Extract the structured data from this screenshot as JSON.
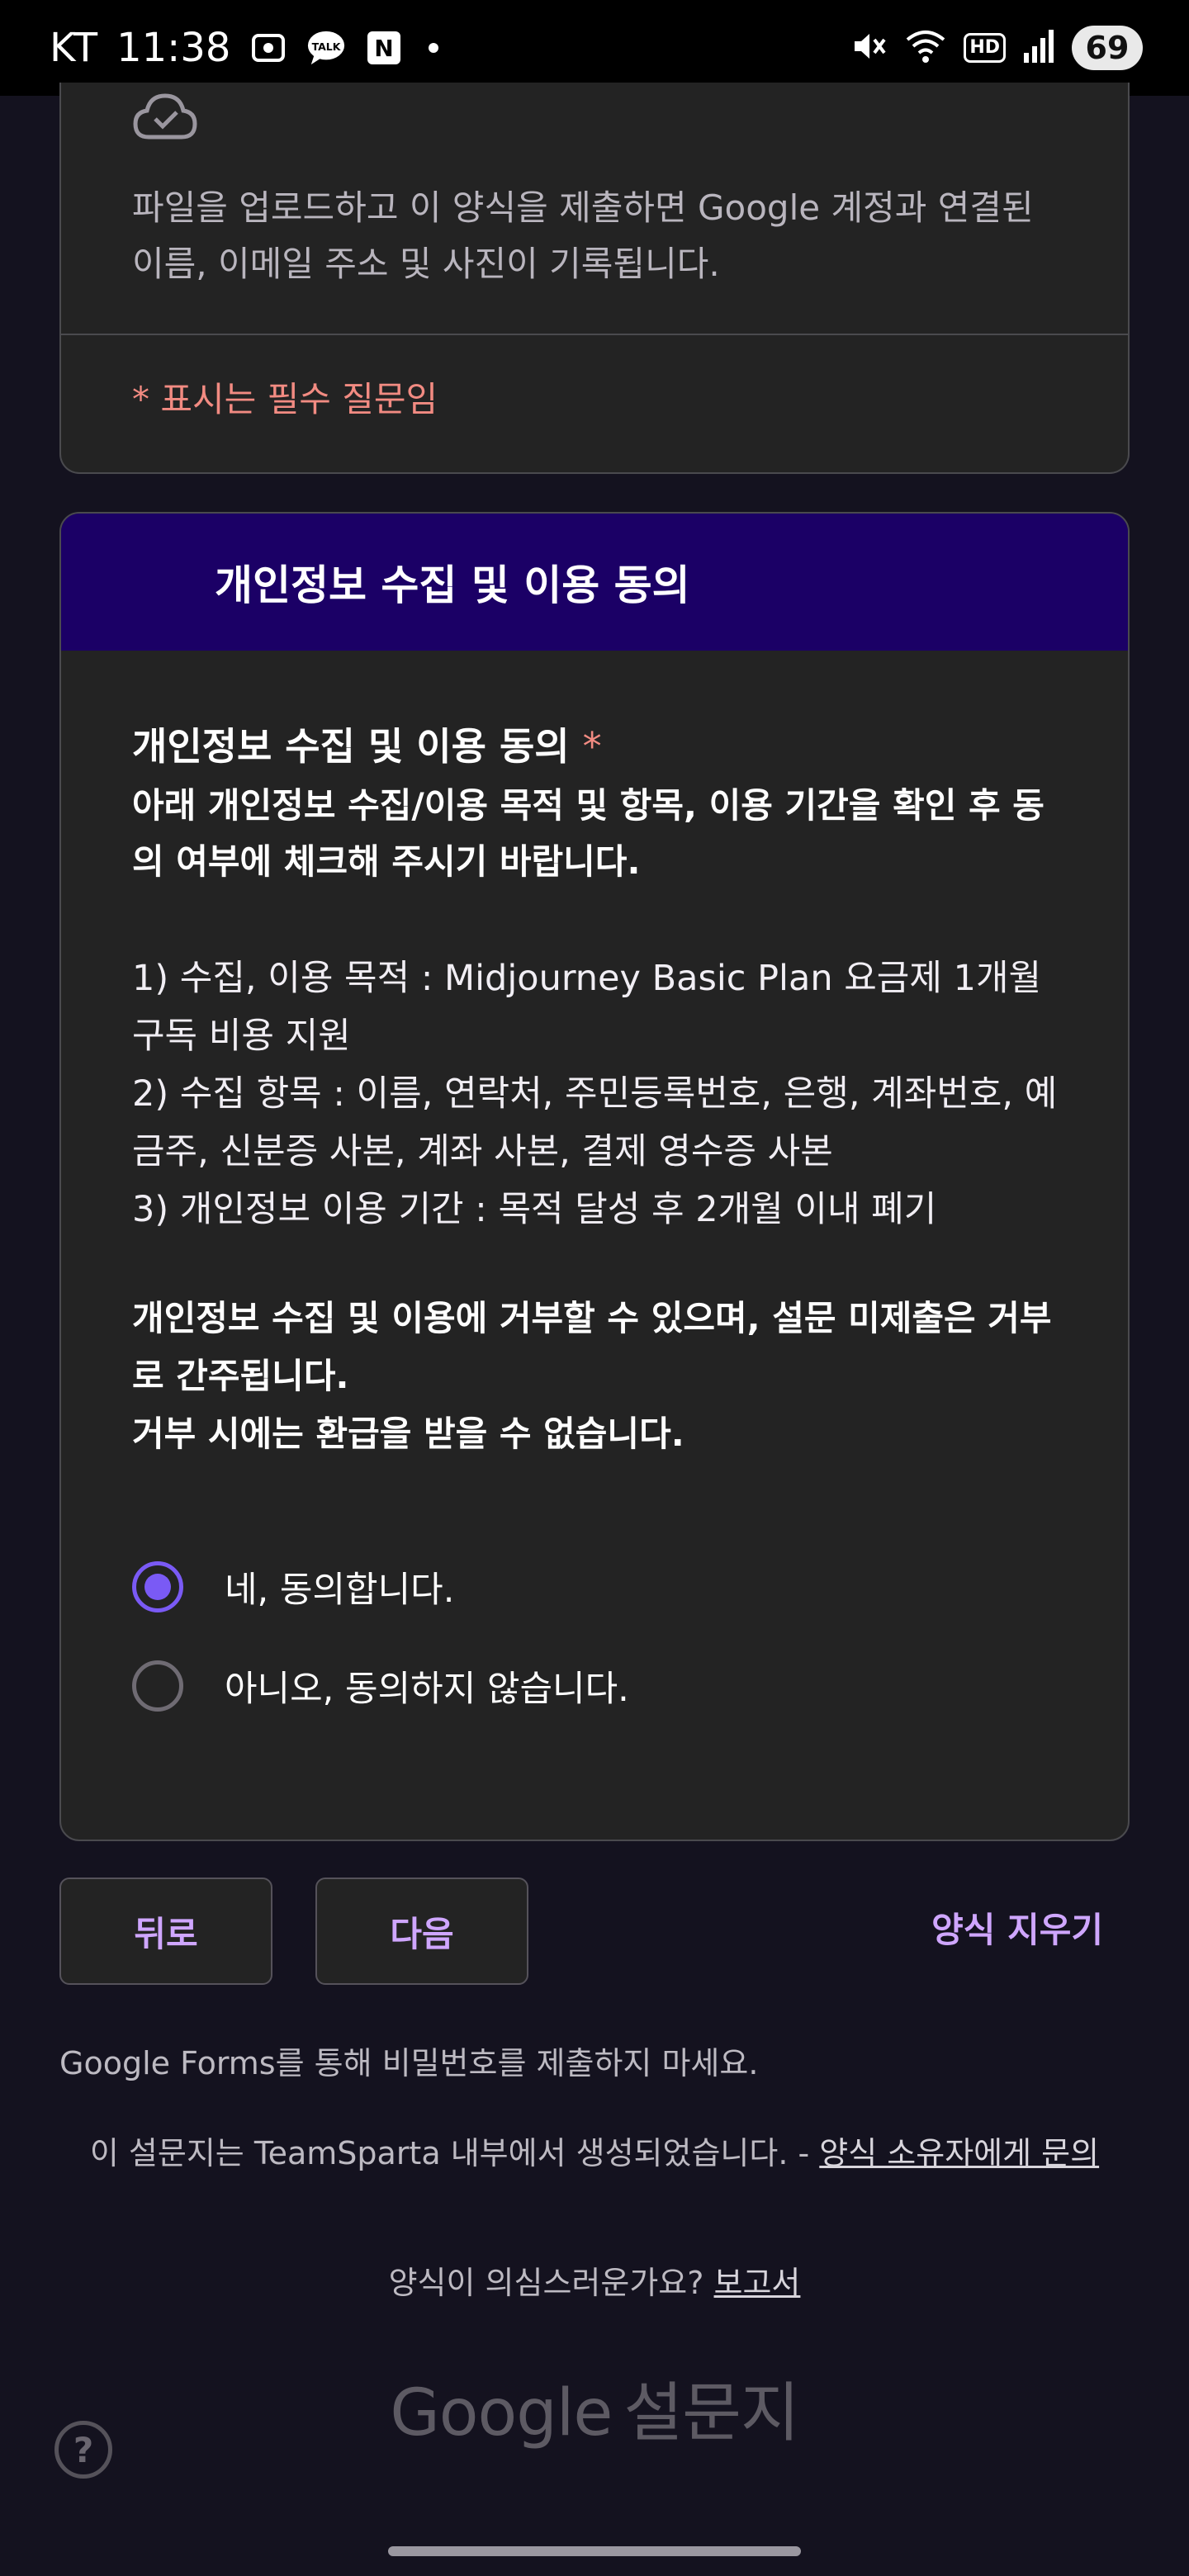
{
  "status_bar": {
    "carrier": "KT",
    "time": "11:38",
    "talk_label": "TALK",
    "n_label": "N",
    "hd_label": "HD",
    "battery": "69"
  },
  "upload_card": {
    "notice": "파일을 업로드하고 이 양식을 제출하면 Google 계정과 연결된 이름, 이메일 주소 및 사진이 기록됩니다.",
    "required_notice": "* 표시는 필수 질문임"
  },
  "section": {
    "title": "개인정보 수집 및 이용 동의",
    "question": {
      "title": "개인정보 수집 및 이용 동의",
      "required_mark": "*",
      "instruction": "아래 개인정보 수집/이용 목적 및 항목, 이용 기간을 확인 후 동의 여부에 체크해 주시기 바랍니다.",
      "item1": "1) 수집, 이용 목적 : Midjourney Basic Plan 요금제 1개월 구독 비용 지원",
      "item2": "2) 수집 항목 : 이름, 연락처, 주민등록번호, 은행, 계좌번호, 예금주, 신분증 사본, 계좌 사본, 결제 영수증 사본",
      "item3": "3) 개인정보 이용 기간 : 목적 달성 후 2개월 이내 폐기",
      "notice_line1": "개인정보 수집 및 이용에 거부할 수 있으며, 설문 미제출은 거부로 간주됩니다.",
      "notice_line2": "거부 시에는 환급을 받을 수 없습니다.",
      "options": [
        {
          "label": "네, 동의합니다.",
          "selected": true
        },
        {
          "label": "아니오, 동의하지 않습니다.",
          "selected": false
        }
      ]
    }
  },
  "navigation": {
    "back_label": "뒤로",
    "next_label": "다음",
    "clear_label": "양식 지우기"
  },
  "footer": {
    "password_warning": "Google Forms를 통해 비밀번호를 제출하지 마세요.",
    "created_text": "이 설문지는 TeamSparta 내부에서 생성되었습니다. - ",
    "owner_link": "양식 소유자에게 문의",
    "suspicious_text": "양식이 의심스러운가요? ",
    "report_link": "보고서",
    "brand_google": "Google",
    "brand_forms": "설문지",
    "help_glyph": "?"
  },
  "colors": {
    "background": "#14121f",
    "card": "#232323",
    "section_header": "#1b0066",
    "accent": "#cfa6ff",
    "radio_selected": "#7a5af5",
    "required": "#f28b82"
  }
}
